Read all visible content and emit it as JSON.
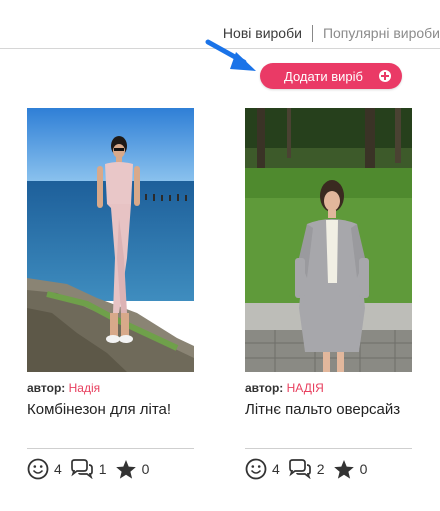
{
  "tabs": {
    "active": "Нові вироби",
    "inactive": "Популярні вироби"
  },
  "actions": {
    "add_label": "Додати виріб"
  },
  "colors": {
    "accent": "#ea3a66",
    "arrow": "#1a73e8",
    "author_name": "#e8405f"
  },
  "cards": [
    {
      "author_label": "автор:",
      "author_name": "Надія",
      "title": "Комбінезон для літа!",
      "likes": "4",
      "comments": "1",
      "favorites": "0"
    },
    {
      "author_label": "автор:",
      "author_name": "НАДІЯ",
      "title": "Літнє пальто оверсайз",
      "likes": "4",
      "comments": "2",
      "favorites": "0"
    }
  ],
  "icons": [
    "smile-icon",
    "comments-icon",
    "star-icon",
    "plus-circle-icon",
    "arrow-pointer-icon"
  ]
}
